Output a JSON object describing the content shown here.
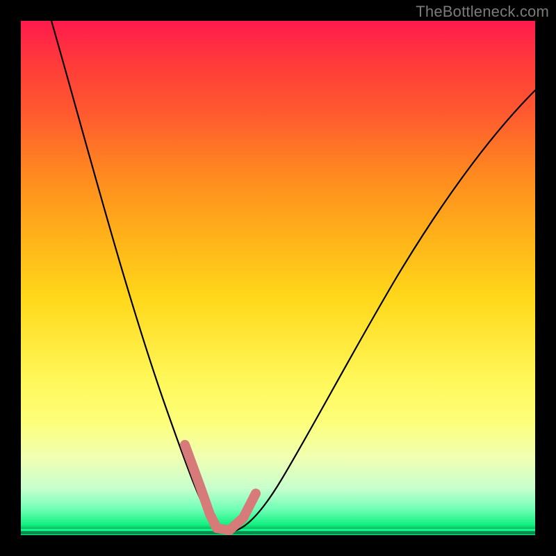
{
  "watermark": "TheBottleneck.com",
  "chart_data": {
    "type": "line",
    "title": "",
    "xlabel": "",
    "ylabel": "",
    "xlim": [
      0,
      100
    ],
    "ylim": [
      0,
      100
    ],
    "grid": false,
    "series": [
      {
        "name": "bottleneck-curve",
        "x": [
          6,
          10,
          14,
          18,
          22,
          26,
          28,
          30,
          32,
          34,
          36,
          38,
          40,
          44,
          48,
          52,
          56,
          60,
          65,
          70,
          75,
          80,
          85,
          90,
          95,
          100
        ],
        "y": [
          100,
          88,
          76,
          64,
          52,
          38,
          30,
          22,
          14,
          8,
          3,
          0.5,
          0,
          4,
          11,
          19,
          28,
          36,
          45,
          53,
          61,
          68,
          74,
          79,
          83,
          87
        ]
      }
    ],
    "annotations": [
      {
        "name": "sweet-spot-marker",
        "x_range": [
          32,
          42
        ],
        "y_max": 18,
        "color": "#d67a7a"
      }
    ],
    "colors": {
      "gradient_top": "#ff1a4d",
      "gradient_mid": "#ffe83a",
      "gradient_bottom": "#11f07f",
      "curve": "#000000",
      "marker": "#d67a7a",
      "frame": "#000000"
    }
  }
}
